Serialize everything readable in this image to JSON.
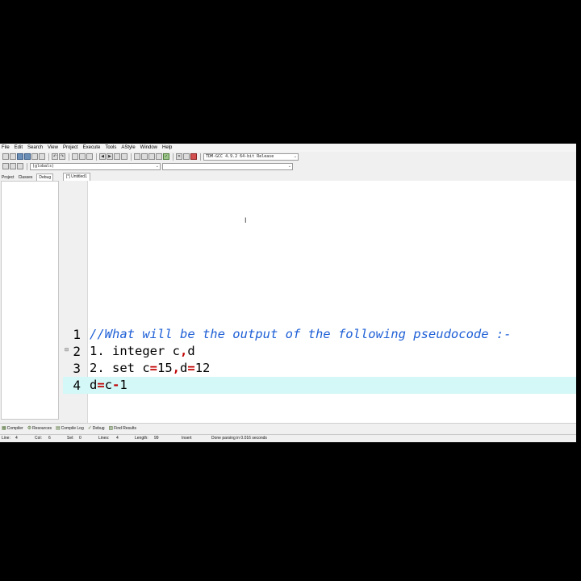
{
  "menu": [
    "File",
    "Edit",
    "Search",
    "View",
    "Project",
    "Execute",
    "Tools",
    "AStyle",
    "Window",
    "Help"
  ],
  "toolbar": {
    "compiler_select": "TDM-GCC 4.9.2 64-bit Release",
    "scope_select": "(globals)",
    "member_select": ""
  },
  "left_panel": {
    "tabs": [
      "Project",
      "Classes",
      "Debug"
    ],
    "active_tab": "Debug"
  },
  "editor": {
    "tab_label": "[*] Untitled1",
    "lines": [
      {
        "num": "1",
        "text": "//What will be the output of the following pseudocode :-"
      },
      {
        "num": "2",
        "text": "1. integer c,d"
      },
      {
        "num": "3",
        "text": "2. set c=15,d=12"
      },
      {
        "num": "4",
        "text": "d=c-1"
      }
    ],
    "current_line": 4
  },
  "bottom_tabs": [
    "Compiler",
    "Resources",
    "Compile Log",
    "Debug",
    "Find Results"
  ],
  "status": {
    "line_label": "Line:",
    "line_value": "4",
    "col_label": "Col:",
    "col_value": "6",
    "sel_label": "Sel:",
    "sel_value": "0",
    "lines_label": "Lines:",
    "lines_value": "4",
    "length_label": "Length:",
    "length_value": "99",
    "mode": "Insert",
    "message": "Done parsing in 0.016 seconds"
  },
  "colors": {
    "comment": "#1e5fd6",
    "operator": "#c00000",
    "number": "#7b2aa0",
    "current_line_bg": "#d4f7f7"
  }
}
